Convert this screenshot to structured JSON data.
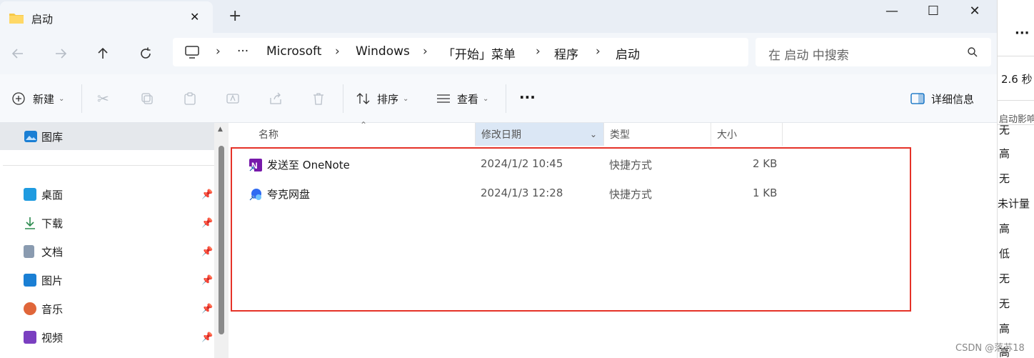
{
  "window": {
    "tab_title": "启动",
    "new_tab": "+",
    "close_tab": "✕",
    "minimize": "—",
    "maximize": "☐",
    "close": "✕"
  },
  "nav": {
    "back_icon": "arrow-left-icon",
    "forward_icon": "arrow-right-icon",
    "up_icon": "arrow-up-icon",
    "refresh_icon": "refresh-icon"
  },
  "breadcrumb": {
    "ellipsis": "···",
    "items": [
      "Microsoft",
      "Windows",
      "「开始」菜单",
      "程序",
      "启动"
    ]
  },
  "search": {
    "placeholder": "在 启动 中搜索"
  },
  "toolbar": {
    "new_label": "新建",
    "sort_label": "排序",
    "view_label": "查看",
    "more": "···",
    "details_label": "详细信息"
  },
  "sidebar": {
    "gallery": "图库",
    "items": [
      {
        "label": "桌面",
        "icon": "desktop-icon",
        "color": "#1f9be0"
      },
      {
        "label": "下载",
        "icon": "download-icon",
        "color": "#2b8a4e"
      },
      {
        "label": "文档",
        "icon": "document-icon",
        "color": "#8a9bb0"
      },
      {
        "label": "图片",
        "icon": "pictures-icon",
        "color": "#1a7fd4"
      },
      {
        "label": "音乐",
        "icon": "music-icon",
        "color": "#e0663a"
      },
      {
        "label": "视频",
        "icon": "video-icon",
        "color": "#7a3fc0"
      }
    ]
  },
  "columns": {
    "name": "名称",
    "modified": "修改日期",
    "type": "类型",
    "size": "大小"
  },
  "files": [
    {
      "name": "发送至 OneNote",
      "modified": "2024/1/2 10:45",
      "type": "快捷方式",
      "size": "2 KB",
      "icon": "onenote-icon"
    },
    {
      "name": "夸克网盘",
      "modified": "2024/1/3 12:28",
      "type": "快捷方式",
      "size": "1 KB",
      "icon": "quark-icon"
    }
  ],
  "right_strip": {
    "dots": "···",
    "time": "2.6 秒",
    "header": "启动影响",
    "values": [
      "无",
      "高",
      "无",
      "未计量",
      "高",
      "低",
      "无",
      "无",
      "高",
      "高"
    ]
  },
  "watermark": "CSDN @落苏18",
  "colors": {
    "highlight": "#e53228",
    "accent": "#0067c0"
  }
}
